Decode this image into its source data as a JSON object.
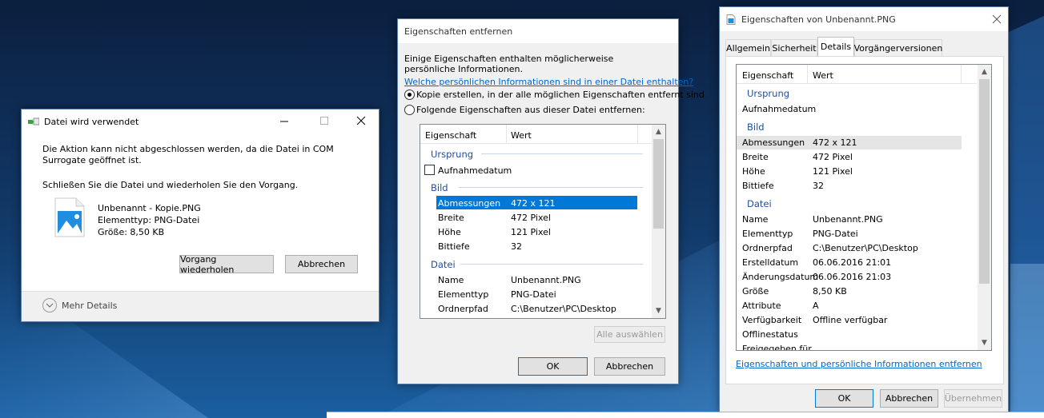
{
  "file_in_use": {
    "title": "Datei wird verwendet",
    "message": "Die Aktion kann nicht abgeschlossen werden, da die Datei in COM Surrogate geöffnet ist.",
    "instruction": "Schließen Sie die Datei und wiederholen Sie den Vorgang.",
    "file_name": "Unbenannt - Kopie.PNG",
    "file_type": "Elementtyp: PNG-Datei",
    "file_size": "Größe: 8,50 KB",
    "retry_label": "Vorgang wiederholen",
    "cancel_label": "Abbrechen",
    "more_details_label": "Mehr Details"
  },
  "remove_props": {
    "title": "Eigenschaften entfernen",
    "intro": "Einige Eigenschaften enthalten möglicherweise persönliche Informationen.",
    "help_link": "Welche persönlichen Informationen sind in einer Datei enthalten?",
    "option_copy": "Kopie erstellen, in der alle möglichen Eigenschaften entfernt sind",
    "option_remove": "Folgende Eigenschaften aus dieser Datei entfernen:",
    "col_property": "Eigenschaft",
    "col_value": "Wert",
    "group_origin": "Ursprung",
    "capture_date": "Aufnahmedatum",
    "group_image": "Bild",
    "group_file": "Datei",
    "rows_image": [
      {
        "name": "Abmessungen",
        "value": "472 x 121"
      },
      {
        "name": "Breite",
        "value": "472 Pixel"
      },
      {
        "name": "Höhe",
        "value": "121 Pixel"
      },
      {
        "name": "Bittiefe",
        "value": "32"
      }
    ],
    "rows_file": [
      {
        "name": "Name",
        "value": "Unbenannt.PNG"
      },
      {
        "name": "Elementtyp",
        "value": "PNG-Datei"
      },
      {
        "name": "Ordnerpfad",
        "value": "C:\\Benutzer\\PC\\Desktop"
      }
    ],
    "select_all_label": "Alle auswählen",
    "ok_label": "OK",
    "cancel_label": "Abbrechen"
  },
  "properties": {
    "title": "Eigenschaften von Unbenannt.PNG",
    "tabs": [
      "Allgemein",
      "Sicherheit",
      "Details",
      "Vorgängerversionen"
    ],
    "col_property": "Eigenschaft",
    "col_value": "Wert",
    "group_origin": "Ursprung",
    "capture_date": "Aufnahmedatum",
    "group_image": "Bild",
    "group_file": "Datei",
    "rows_image": [
      {
        "name": "Abmessungen",
        "value": "472 x 121"
      },
      {
        "name": "Breite",
        "value": "472 Pixel"
      },
      {
        "name": "Höhe",
        "value": "121 Pixel"
      },
      {
        "name": "Bittiefe",
        "value": "32"
      }
    ],
    "rows_file": [
      {
        "name": "Name",
        "value": "Unbenannt.PNG"
      },
      {
        "name": "Elementtyp",
        "value": "PNG-Datei"
      },
      {
        "name": "Ordnerpfad",
        "value": "C:\\Benutzer\\PC\\Desktop"
      },
      {
        "name": "Erstelldatum",
        "value": "06.06.2016 21:01"
      },
      {
        "name": "Änderungsdatum",
        "value": "06.06.2016 21:03"
      },
      {
        "name": "Größe",
        "value": "8,50 KB"
      },
      {
        "name": "Attribute",
        "value": "A"
      },
      {
        "name": "Verfügbarkeit",
        "value": "Offline verfügbar"
      },
      {
        "name": "Offlinestatus",
        "value": ""
      },
      {
        "name": "Freigegeben für",
        "value": ""
      }
    ],
    "remove_link": "Eigenschaften und persönliche Informationen entfernen",
    "ok_label": "OK",
    "cancel_label": "Abbrechen",
    "apply_label": "Übernehmen"
  },
  "colors": {
    "accent": "#0078d7",
    "link": "#0066cc",
    "group": "#1e4e9c"
  }
}
